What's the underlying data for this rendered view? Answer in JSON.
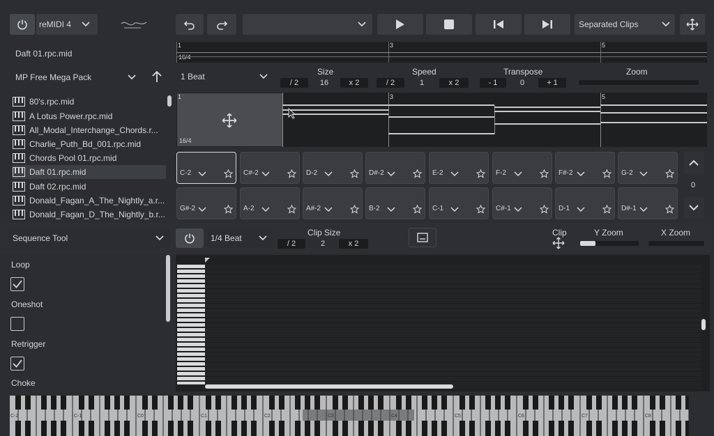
{
  "top": {
    "plugin_name": "reMIDI 4",
    "preset_value": "",
    "clip_mode": "Separated Clips"
  },
  "file": {
    "current": "Daft 01.rpc.mid",
    "ruler": [
      "1",
      "3",
      "5"
    ],
    "time_sig": "16/4"
  },
  "library": {
    "pack": "MP Free Mega Pack",
    "items": [
      "80's.rpc.mid",
      "A Lotus Power.rpc.mid",
      "All_Modal_Interchange_Chords.r...",
      "Charlie_Puth_Bd_001.rpc.mid",
      "Chords Pool 01.rpc.mid",
      "Daft 01.rpc.mid",
      "Daft 02.rpc.mid",
      "Donald_Fagan_A_The_Nightly_a.r...",
      "Donald_Fagan_D_The_Nightly_b.r..."
    ],
    "selected_index": 5
  },
  "controls": {
    "grid": "1 Beat",
    "size_label": "Size",
    "size_div": "/ 2",
    "size_val": "16",
    "size_mul": "x 2",
    "speed_label": "Speed",
    "speed_div": "/ 2",
    "speed_val": "1",
    "speed_mul": "x 2",
    "transpose_label": "Transpose",
    "tr_down": "- 1",
    "tr_val": "0",
    "tr_up": "+ 1",
    "zoom_label": "Zoom"
  },
  "clip_ruler": [
    "1",
    "3",
    "5"
  ],
  "clip_time_sig": "16/4",
  "pads_row1": [
    "C-2",
    "C#-2",
    "D-2",
    "D#-2",
    "E-2",
    "F-2",
    "F#-2",
    "G-2"
  ],
  "pads_row2": [
    "G#-2",
    "A-2",
    "A#-2",
    "B-2",
    "C-1",
    "C#-1",
    "D-1",
    "D#-1"
  ],
  "pad_page": "0",
  "seq": {
    "tool": "Sequence Tool",
    "grid": "1/4 Beat",
    "clip_size_label": "Clip Size",
    "cs_div": "/ 2",
    "cs_val": "2",
    "cs_mul": "x 2",
    "clip_label": "Clip",
    "y_zoom": "Y Zoom",
    "x_zoom": "X Zoom"
  },
  "options": [
    {
      "label": "Loop",
      "checked": true
    },
    {
      "label": "Oneshot",
      "checked": false
    },
    {
      "label": "Retrigger",
      "checked": true
    },
    {
      "label": "Choke",
      "checked": false
    }
  ],
  "keyboard_labels": [
    "C-2",
    "C-1",
    "C0",
    "C1",
    "C2",
    "C3",
    "C4",
    "C5",
    "C6",
    "C7",
    "C8"
  ]
}
